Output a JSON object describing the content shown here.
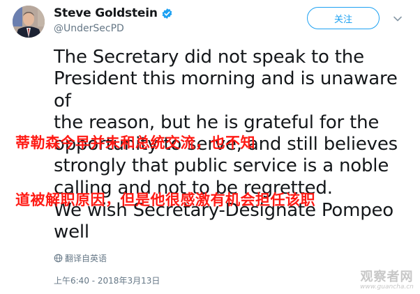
{
  "header": {
    "name": "Steve Goldstein",
    "handle": "@UnderSecPD",
    "follow_label": "关注"
  },
  "tweet": {
    "paragraph1": "The Secretary did not speak to the\nPresident this morning and is unaware of\nthe reason, but he is grateful for the\nopportunity to serve, and still believes\nstrongly that public service is a noble\ncalling and not to be regretted.",
    "paragraph2": "We wish Secretary-Designate Pompeo\nwell"
  },
  "overlay": {
    "line1": "蒂勒森今早并未和总统交流，也不知",
    "line2": "道被解职原因，但是他很感激有机会担任该职"
  },
  "translate_label": "翻译自英语",
  "timestamp": "上午6:40 - 2018年3月13日",
  "watermark": {
    "main": "观察者网",
    "url": "www.guancha.cn"
  },
  "colors": {
    "accent": "#1da1f2",
    "overlay_text": "#ff1a14"
  },
  "icons": [
    "avatar",
    "verified-badge-icon",
    "chevron-down-icon",
    "globe-icon"
  ]
}
